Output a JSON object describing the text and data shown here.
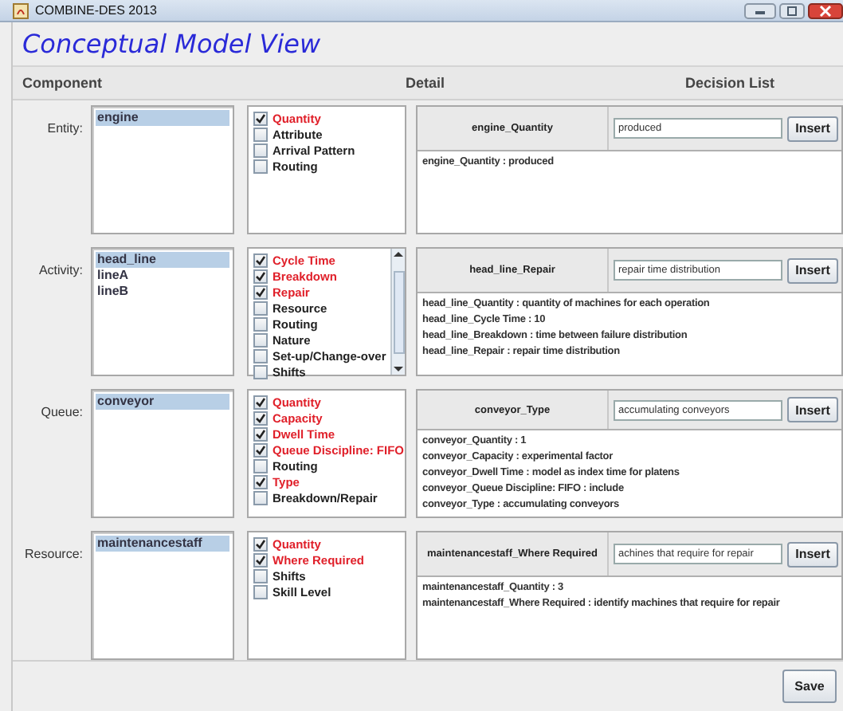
{
  "window": {
    "title": "COMBINE-DES 2013"
  },
  "heading": "Conceptual Model View",
  "columns": [
    "Component",
    "Detail",
    "Decision List"
  ],
  "sections": [
    {
      "label": "Entity:",
      "components": [
        {
          "name": "engine",
          "selected": true
        }
      ],
      "scrollable": false,
      "details": [
        {
          "label": "Quantity",
          "checked": true
        },
        {
          "label": "Attribute",
          "checked": false
        },
        {
          "label": "Arrival Pattern",
          "checked": false
        },
        {
          "label": "Routing",
          "checked": false
        }
      ],
      "decision": {
        "label": "engine_Quantity",
        "value": "produced",
        "button": "Insert",
        "lines": [
          "engine_Quantity : produced"
        ]
      }
    },
    {
      "label": "Activity:",
      "components": [
        {
          "name": "head_line",
          "selected": true
        },
        {
          "name": "lineA",
          "selected": false
        },
        {
          "name": "lineB",
          "selected": false
        }
      ],
      "scrollable": true,
      "details": [
        {
          "label": "Cycle Time",
          "checked": true
        },
        {
          "label": "Breakdown",
          "checked": true
        },
        {
          "label": "Repair",
          "checked": true
        },
        {
          "label": "Resource",
          "checked": false
        },
        {
          "label": "Routing",
          "checked": false
        },
        {
          "label": "Nature",
          "checked": false
        },
        {
          "label": "Set-up/Change-over",
          "checked": false
        },
        {
          "label": "Shifts",
          "checked": false
        }
      ],
      "decision": {
        "label": "head_line_Repair",
        "value": "repair time distribution",
        "button": "Insert",
        "lines": [
          "head_line_Quantity : quantity of machines for each operation",
          "head_line_Cycle Time : 10",
          "head_line_Breakdown : time between failure distribution",
          "head_line_Repair : repair time distribution"
        ]
      }
    },
    {
      "label": "Queue:",
      "components": [
        {
          "name": "conveyor",
          "selected": true
        }
      ],
      "scrollable": false,
      "details": [
        {
          "label": "Quantity",
          "checked": true
        },
        {
          "label": "Capacity",
          "checked": true
        },
        {
          "label": "Dwell Time",
          "checked": true
        },
        {
          "label": "Queue Discipline: FIFO",
          "checked": true
        },
        {
          "label": "Routing",
          "checked": false
        },
        {
          "label": "Type",
          "checked": true
        },
        {
          "label": "Breakdown/Repair",
          "checked": false
        }
      ],
      "decision": {
        "label": "conveyor_Type",
        "value": "accumulating conveyors",
        "button": "Insert",
        "lines": [
          "conveyor_Quantity : 1",
          "conveyor_Capacity : experimental factor",
          "conveyor_Dwell Time : model as index time for platens",
          "conveyor_Queue Discipline: FIFO : include",
          "conveyor_Type : accumulating conveyors"
        ]
      }
    },
    {
      "label": "Resource:",
      "components": [
        {
          "name": "maintenancestaff",
          "selected": true
        }
      ],
      "scrollable": false,
      "details": [
        {
          "label": "Quantity",
          "checked": true
        },
        {
          "label": "Where Required",
          "checked": true
        },
        {
          "label": "Shifts",
          "checked": false
        },
        {
          "label": "Skill Level",
          "checked": false
        }
      ],
      "decision": {
        "label": "maintenancestaff_Where Required",
        "value": "achines that require for repair",
        "button": "Insert",
        "lines": [
          "maintenancestaff_Quantity : 3",
          "maintenancestaff_Where Required : identify machines that require for repair"
        ]
      }
    }
  ],
  "save_button": "Save"
}
